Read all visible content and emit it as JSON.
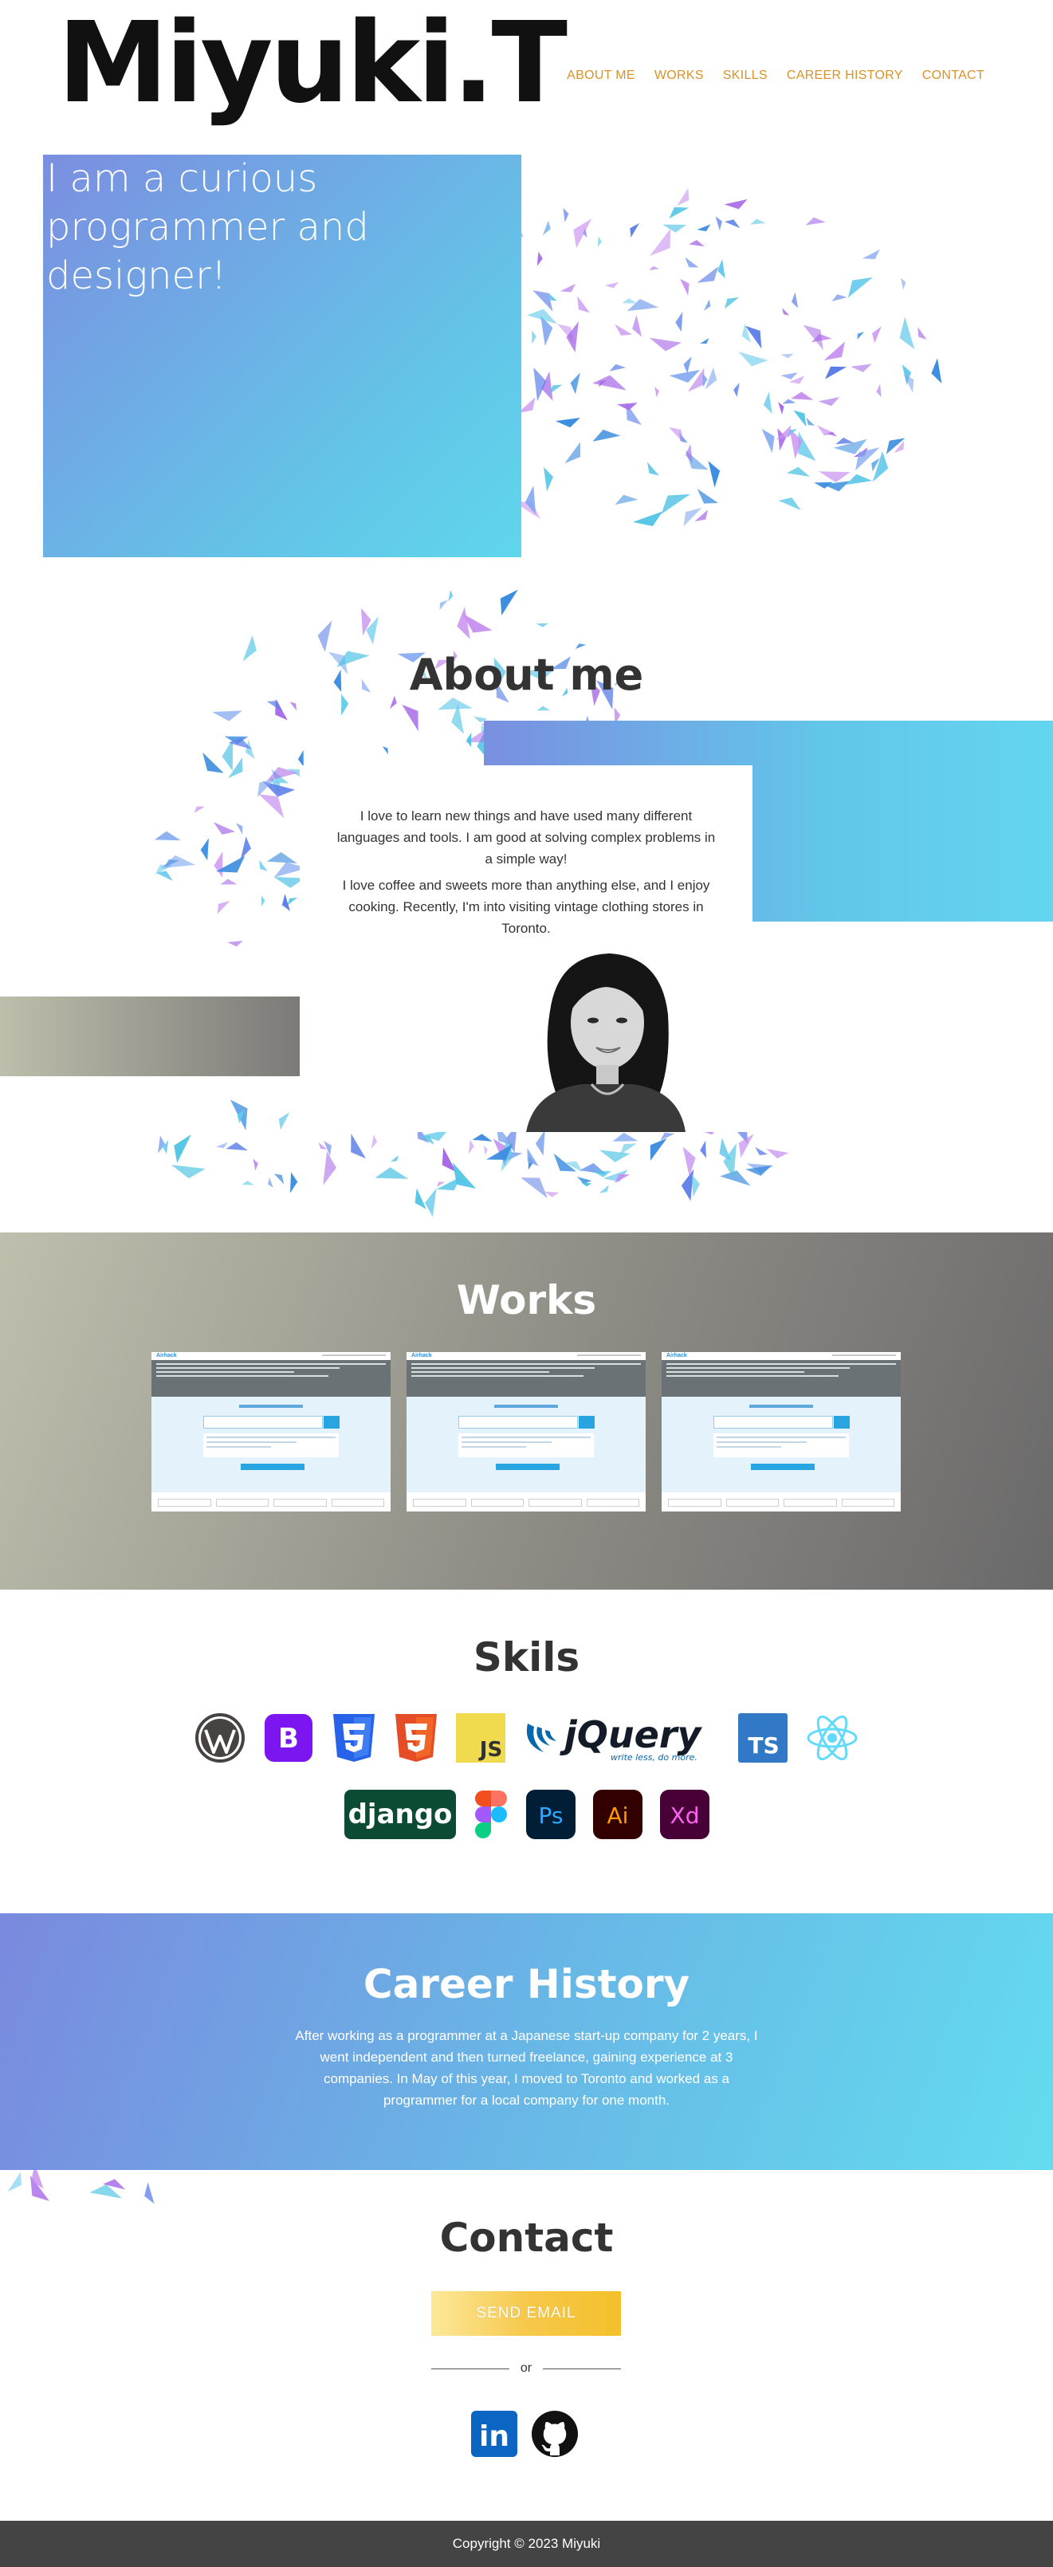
{
  "header": {
    "logo": "Miyuki.T",
    "nav": [
      {
        "label": "ABOUT ME"
      },
      {
        "label": "WORKS"
      },
      {
        "label": "SKILLS"
      },
      {
        "label": "CAREER HISTORY"
      },
      {
        "label": "CONTACT"
      }
    ]
  },
  "hero": {
    "line1": "I am a curious",
    "line2": "programmer and",
    "line3": "designer!"
  },
  "about": {
    "title": "About me",
    "paragraph1": "I love to learn new things and have used many different languages and tools. I am good at solving complex problems in a simple way!",
    "paragraph2": "I love coffee and sweets more than anything else, and I enjoy cooking. Recently, I'm into visiting vintage clothing stores in Toronto."
  },
  "works": {
    "title": "Works",
    "items": [
      {
        "logo": "Airhack"
      },
      {
        "logo": "Airhack"
      },
      {
        "logo": "Airhack"
      }
    ]
  },
  "skills": {
    "title": "Skils",
    "icons": [
      "wordpress-icon",
      "bootstrap-icon",
      "css3-icon",
      "html5-icon",
      "javascript-icon",
      "jquery-icon",
      "typescript-icon",
      "react-icon",
      "django-icon",
      "figma-icon",
      "photoshop-icon",
      "illustrator-icon",
      "adobe-xd-icon"
    ],
    "labels": {
      "bootstrap": "B",
      "js": "JS",
      "ts": "TS",
      "jquery": "jQuery",
      "jquery_tagline": "write less, do more.",
      "django": "django",
      "ps": "Ps",
      "ai": "Ai",
      "xd": "Xd"
    }
  },
  "career": {
    "title": "Career History",
    "text": "After working as a programmer at a Japanese start-up company for 2 years, I went independent and then turned freelance, gaining experience at 3 companies. In May of this year, I moved to Toronto and worked as a programmer for a local company for one month."
  },
  "contact": {
    "title": "Contact",
    "send_label": "SEND EMAIL",
    "or_label": "or",
    "linkedin_label": "in"
  },
  "footer": {
    "copyright": "Copyright © 2023 Miyuki"
  },
  "colors": {
    "accent_nav": "#d8922a",
    "gradient_blue_start": "#7b8ee0",
    "gradient_blue_end": "#63d5ef",
    "button_yellow": "#f4c02a",
    "footer_bg": "#444444"
  }
}
